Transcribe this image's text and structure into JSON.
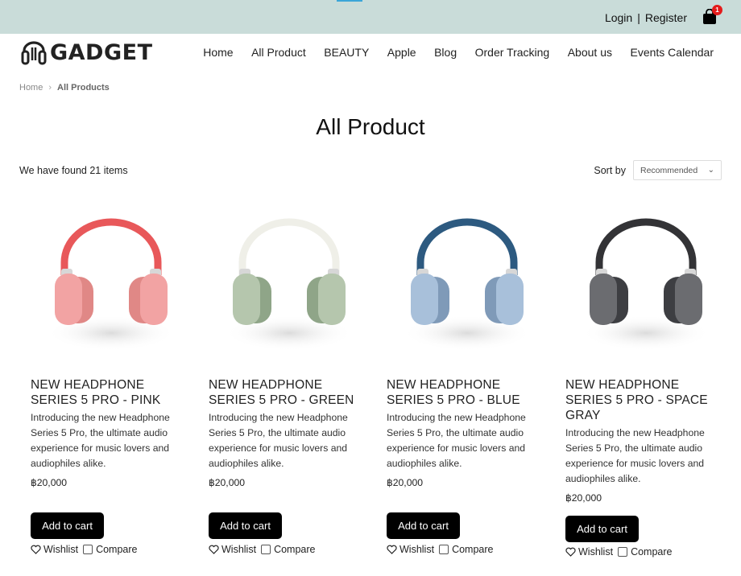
{
  "topbar": {
    "login": "Login",
    "separator": "|",
    "register": "Register",
    "cart_count": "1"
  },
  "logo": {
    "text": "GADGET"
  },
  "nav": [
    "Home",
    "All Product",
    "BEAUTY",
    "Apple",
    "Blog",
    "Order Tracking",
    "About us",
    "Events Calendar"
  ],
  "breadcrumb": {
    "home": "Home",
    "current": "All Products"
  },
  "page_title": "All Product",
  "results": {
    "found": "We have found 21 items",
    "sort_label": "Sort by",
    "sort_value": "Recommended"
  },
  "products": [
    {
      "name": "NEW HEADPHONE SERIES 5 PRO - PINK",
      "desc": "Introducing the new Headphone Series 5 Pro, the ultimate audio experience for music lovers and audiophiles alike.",
      "price": "฿20,000",
      "add": "Add to cart",
      "wishlist": "Wishlist",
      "compare": "Compare",
      "band": "#e8585a",
      "cup": "#f2a3a3",
      "cushion": "#e08886"
    },
    {
      "name": "NEW HEADPHONE SERIES 5 PRO - GREEN",
      "desc": "Introducing the new Headphone Series 5 Pro, the ultimate audio experience for music lovers and audiophiles alike.",
      "price": "฿20,000",
      "add": "Add to cart",
      "wishlist": "Wishlist",
      "compare": "Compare",
      "band": "#efefe8",
      "cup": "#b5c6ad",
      "cushion": "#8fa588"
    },
    {
      "name": "NEW HEADPHONE SERIES 5 PRO - BLUE",
      "desc": "Introducing the new Headphone Series 5 Pro, the ultimate audio experience for music lovers and audiophiles alike.",
      "price": "฿20,000",
      "add": "Add to cart",
      "wishlist": "Wishlist",
      "compare": "Compare",
      "band": "#2d5a80",
      "cup": "#a8c0da",
      "cushion": "#7f9ab8"
    },
    {
      "name": "NEW HEADPHONE SERIES 5 PRO - SPACE GRAY",
      "desc": "Introducing the new Headphone Series 5 Pro, the ultimate audio experience for music lovers and audiophiles alike.",
      "price": "฿20,000",
      "add": "Add to cart",
      "wishlist": "Wishlist",
      "compare": "Compare",
      "band": "#333336",
      "cup": "#6b6c70",
      "cushion": "#3d3e42"
    }
  ]
}
